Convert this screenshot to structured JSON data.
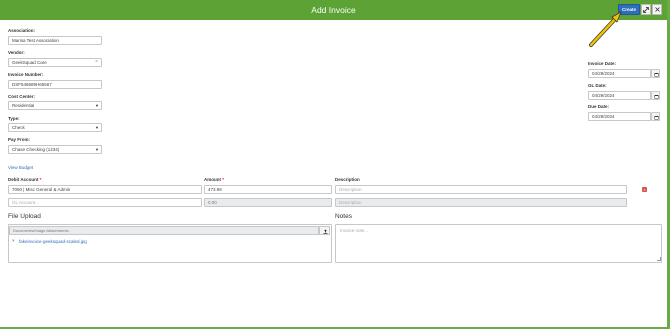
{
  "header": {
    "title": "Add Invoice",
    "create_label": "Create",
    "expand_icon": "expand-icon",
    "close_icon": "close-icon",
    "color": "#5ca234"
  },
  "form": {
    "association": {
      "label": "Association:",
      "value": "Marisa Test Association"
    },
    "vendor": {
      "label": "Vendor:",
      "value": "GeekSquad Care"
    },
    "invoice_number": {
      "label": "Invoice Number:",
      "value": "DSF546689H65567"
    },
    "cost_center": {
      "label": "Cost Center:",
      "value": "Residential"
    },
    "type": {
      "label": "Type:",
      "value": "Check"
    },
    "pay_from": {
      "label": "Pay From:",
      "value": "Chase Checking (1234)"
    },
    "invoice_date": {
      "label": "Invoice Date:",
      "value": "04/29/2024"
    },
    "gl_date": {
      "label": "GL Date:",
      "value": "04/29/2024"
    },
    "due_date": {
      "label": "Due Date:",
      "value": "04/29/2024"
    },
    "view_budget": "View Budget"
  },
  "lines": {
    "debit_label": "Debit Account",
    "amount_label": "Amount",
    "description_label": "Description",
    "required_mark": "*",
    "rows": [
      {
        "account": "7050 | Misc General & Admin",
        "amount": "473.99",
        "description": "Description"
      },
      {
        "account": "GL Account...",
        "amount": "0.00",
        "description": "Description"
      }
    ]
  },
  "file_upload": {
    "title": "File Upload",
    "placeholder": "Documents/Image Attachments",
    "file_name": "fakeinvoice-geeksquad-scaled.jpg"
  },
  "notes": {
    "title": "Notes",
    "placeholder": "Invoice note..."
  }
}
